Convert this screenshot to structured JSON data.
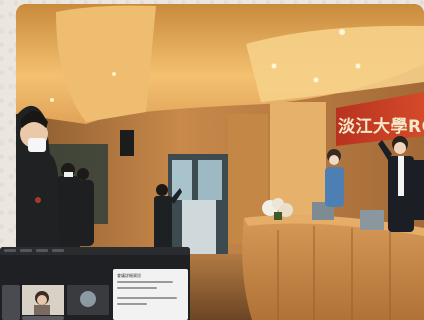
{
  "photo": {
    "banner_text": "淡江大學ROTC"
  },
  "meeting_overlay": {
    "panel_title": "會議詳細資訊"
  }
}
